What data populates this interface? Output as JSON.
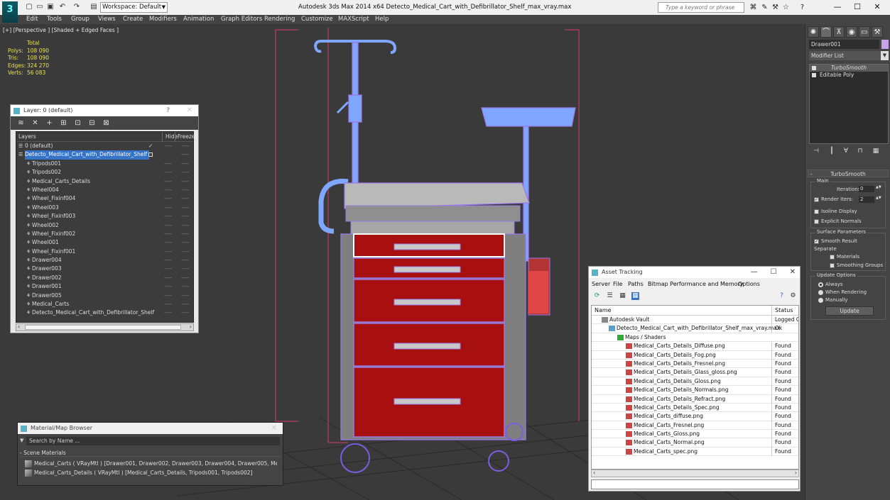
{
  "titlebar": {
    "logo": "3",
    "workspace": "Workspace: Default",
    "title": "Autodesk 3ds Max  2014 x64     Detecto_Medical_Cart_with_Defibrillator_Shelf_max_vray.max",
    "search_placeholder": "Type a keyword or phrase",
    "help_icon": "?"
  },
  "menu": [
    "Edit",
    "Tools",
    "Group",
    "Views",
    "Create",
    "Modifiers",
    "Animation",
    "Graph Editors",
    "Rendering",
    "Customize",
    "MAXScript",
    "Help"
  ],
  "viewport": {
    "label": "[+] [Perspective ] [Shaded + Edged Faces ]",
    "stats": {
      "total_label": "Total",
      "rows": [
        {
          "k": "Polys:",
          "v": "108 090"
        },
        {
          "k": "Tris:",
          "v": "108 090"
        },
        {
          "k": "Edges:",
          "v": "324 270"
        },
        {
          "k": "Verts:",
          "v": "56 083"
        }
      ]
    }
  },
  "layer_panel": {
    "title": "Layer: 0 (default)",
    "help": "?",
    "columns": {
      "layers": "Layers",
      "hide": "Hide",
      "freeze": "Freeze"
    },
    "rows": [
      {
        "name": "0 (default)",
        "level": 0,
        "hide": "----",
        "freeze": "----",
        "check": "✓"
      },
      {
        "name": "Detecto_Medical_Cart_with_Defibrillator_Shelf",
        "level": 0,
        "hide": "",
        "freeze": "----",
        "selected": true
      },
      {
        "name": "Tripods001",
        "level": 1,
        "hide": "----",
        "freeze": "----"
      },
      {
        "name": "Tripods002",
        "level": 1,
        "hide": "----",
        "freeze": "----"
      },
      {
        "name": "Medical_Carts_Details",
        "level": 1,
        "hide": "----",
        "freeze": "----"
      },
      {
        "name": "Wheel004",
        "level": 1,
        "hide": "----",
        "freeze": "----"
      },
      {
        "name": "Wheel_Fixinf004",
        "level": 1,
        "hide": "----",
        "freeze": "----"
      },
      {
        "name": "Wheel003",
        "level": 1,
        "hide": "----",
        "freeze": "----"
      },
      {
        "name": "Wheel_Fixinf003",
        "level": 1,
        "hide": "----",
        "freeze": "----"
      },
      {
        "name": "Wheel002",
        "level": 1,
        "hide": "----",
        "freeze": "----"
      },
      {
        "name": "Wheel_Fixinf002",
        "level": 1,
        "hide": "----",
        "freeze": "----"
      },
      {
        "name": "Wheel001",
        "level": 1,
        "hide": "----",
        "freeze": "----"
      },
      {
        "name": "Wheel_Fixinf001",
        "level": 1,
        "hide": "----",
        "freeze": "----"
      },
      {
        "name": "Drawer004",
        "level": 1,
        "hide": "----",
        "freeze": "----"
      },
      {
        "name": "Drawer003",
        "level": 1,
        "hide": "----",
        "freeze": "----"
      },
      {
        "name": "Drawer002",
        "level": 1,
        "hide": "----",
        "freeze": "----"
      },
      {
        "name": "Drawer001",
        "level": 1,
        "hide": "----",
        "freeze": "----"
      },
      {
        "name": "Drawer005",
        "level": 1,
        "hide": "----",
        "freeze": "----"
      },
      {
        "name": "Medical_Carts",
        "level": 1,
        "hide": "----",
        "freeze": "----"
      },
      {
        "name": "Detecto_Medical_Cart_with_Defibrillator_Shelf",
        "level": 1,
        "hide": "----",
        "freeze": "----"
      }
    ]
  },
  "material_browser": {
    "title": "Material/Map Browser",
    "search_placeholder": "Search by Name ...",
    "section": "- Scene Materials",
    "rows": [
      {
        "name": "Medical_Carts  ( VRayMtl ) [Drawer001, Drawer002, Drawer003, Drawer004, Drawer005, Medical_C",
        "tail": "..."
      },
      {
        "name": "Medical_Carts_Details ( VRayMtl ) [Medical_Carts_Details, Tripods001, Tripods002]",
        "tail": ""
      }
    ]
  },
  "asset_tracking": {
    "title": "Asset Tracking",
    "menu": [
      "Server",
      "File",
      "Paths",
      "Bitmap Performance and Memory",
      "Options"
    ],
    "columns": {
      "name": "Name",
      "status": "Status"
    },
    "rows": [
      {
        "name": "Autodesk Vault",
        "status": "Logged O",
        "level": 0,
        "icon": "vault"
      },
      {
        "name": "Detecto_Medical_Cart_with_Defibrillator_Shelf_max_vray.max",
        "status": "Ok",
        "level": 1,
        "icon": "max"
      },
      {
        "name": "Maps / Shaders",
        "status": "",
        "level": 2,
        "icon": "folder"
      },
      {
        "name": "Medical_Carts_Details_Diffuse.png",
        "status": "Found",
        "level": 3,
        "icon": "png"
      },
      {
        "name": "Medical_Carts_Details_Fog.png",
        "status": "Found",
        "level": 3,
        "icon": "png"
      },
      {
        "name": "Medical_Carts_Details_Fresnel.png",
        "status": "Found",
        "level": 3,
        "icon": "png"
      },
      {
        "name": "Medical_Carts_Details_Glass_gloss.png",
        "status": "Found",
        "level": 3,
        "icon": "png"
      },
      {
        "name": "Medical_Carts_Details_Gloss.png",
        "status": "Found",
        "level": 3,
        "icon": "png"
      },
      {
        "name": "Medical_Carts_Details_Normals.png",
        "status": "Found",
        "level": 3,
        "icon": "png"
      },
      {
        "name": "Medical_Carts_Details_Refract.png",
        "status": "Found",
        "level": 3,
        "icon": "png"
      },
      {
        "name": "Medical_Carts_Details_Spec.png",
        "status": "Found",
        "level": 3,
        "icon": "png"
      },
      {
        "name": "Medical_Carts_diffuse.png",
        "status": "Found",
        "level": 3,
        "icon": "png"
      },
      {
        "name": "Medical_Carts_Fresnel.png",
        "status": "Found",
        "level": 3,
        "icon": "png"
      },
      {
        "name": "Medical_Carts_Gloss.png",
        "status": "Found",
        "level": 3,
        "icon": "png"
      },
      {
        "name": "Medical_Carts_Normal.png",
        "status": "Found",
        "level": 3,
        "icon": "png"
      },
      {
        "name": "Medical_Carts_spec.png",
        "status": "Found",
        "level": 3,
        "icon": "png"
      }
    ]
  },
  "command_panel": {
    "object_name": "Drawer001",
    "object_color": "#c7a3e8",
    "modifier_list": "Modifier List",
    "stack": [
      "TurboSmooth",
      "Editable Poly"
    ],
    "turbosmooth": {
      "title": "TurboSmooth",
      "main_label": "Main",
      "iterations_label": "Iterations:",
      "iterations": "0",
      "render_iters_label": "Render Iters:",
      "render_iters": "2",
      "isoline": "Isoline Display",
      "explicit": "Explicit Normals",
      "surface_label": "Surface Parameters",
      "smooth_result": "Smooth Result",
      "separate": "Separate",
      "materials": "Materials",
      "smoothing_groups": "Smoothing Groups",
      "update_label": "Update Options",
      "always": "Always",
      "when_rendering": "When Rendering",
      "manually": "Manually",
      "update_button": "Update"
    }
  }
}
